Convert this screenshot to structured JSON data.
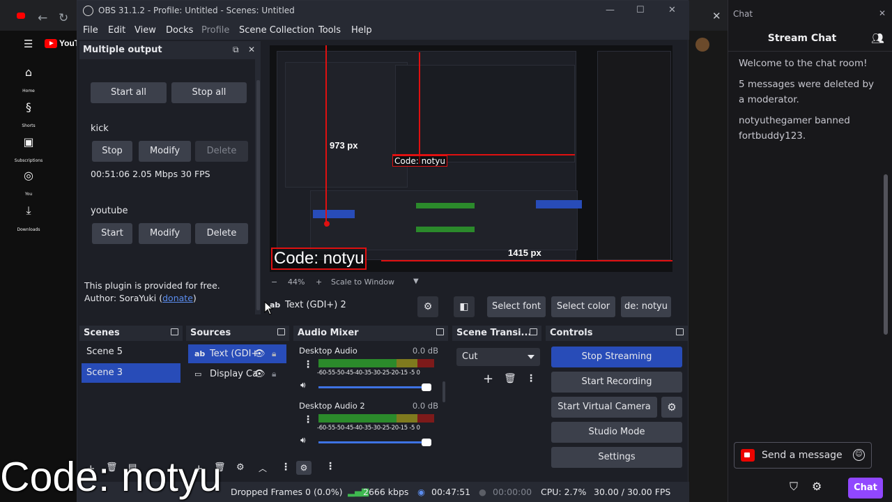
{
  "browser": {
    "youtube_logo": "YouTube",
    "nav": [
      {
        "label": "Home",
        "icon": "home-icon"
      },
      {
        "label": "Shorts",
        "icon": "shorts-icon"
      },
      {
        "label": "Subscriptions",
        "icon": "subscriptions-icon"
      },
      {
        "label": "You",
        "icon": "you-icon"
      },
      {
        "label": "Downloads",
        "icon": "download-icon"
      }
    ]
  },
  "chat": {
    "window_title": "Chat",
    "header": "Stream Chat",
    "messages": [
      "Welcome to the chat room!",
      "5 messages were deleted by a moderator.",
      "notyuthegamer banned fortbuddy123."
    ],
    "input_placeholder": "Send a message",
    "chat_button": "Chat"
  },
  "obs": {
    "title": "OBS 31.1.2 - Profile: Untitled - Scenes: Untitled",
    "menu": [
      "File",
      "Edit",
      "View",
      "Docks",
      "Profile",
      "Scene Collection",
      "Tools",
      "Help"
    ],
    "multiple_output": {
      "title": "Multiple output",
      "start_all": "Start all",
      "stop_all": "Stop all",
      "targets": [
        {
          "name": "kick",
          "buttons": [
            "Stop",
            "Modify",
            "Delete"
          ],
          "stats": "00:51:06  2.05 Mbps  30 FPS"
        },
        {
          "name": "youtube",
          "buttons": [
            "Start",
            "Modify",
            "Delete"
          ]
        }
      ],
      "info_line1": "This plugin is provided for free.",
      "info_line2_prefix": "Author: SoraYuki (",
      "info_link": "donate",
      "info_line2_suffix": ")"
    },
    "preview": {
      "px_label_1": "973 px",
      "px_label_2": "1415 px",
      "code_text": "Code: notyu",
      "zoom": "44%",
      "scale_mode": "Scale to Window"
    },
    "context_bar": {
      "source": "Text (GDI+) 2",
      "select_font": "Select font",
      "select_color": "Select color",
      "text_preview": "de: notyu"
    },
    "scenes": {
      "title": "Scenes",
      "items": [
        "Scene 5",
        "Scene 3"
      ],
      "selected": "Scene 3"
    },
    "sources": {
      "title": "Sources",
      "items": [
        {
          "name": "Text (GDI+",
          "icon": "text-icon"
        },
        {
          "name": "Display Ca",
          "icon": "display-icon"
        }
      ]
    },
    "audio_mixer": {
      "title": "Audio Mixer",
      "ticks": "-60-55-50-45-40-35-30-25-20-15 -5  0",
      "channels": [
        {
          "name": "Desktop Audio",
          "db": "0.0 dB"
        },
        {
          "name": "Desktop Audio 2",
          "db": "0.0 dB"
        }
      ]
    },
    "transitions": {
      "title": "Scene Transi...",
      "selected": "Cut"
    },
    "controls": {
      "title": "Controls",
      "buttons": [
        "Stop Streaming",
        "Start Recording",
        "Start Virtual Camera",
        "Studio Mode",
        "Settings"
      ]
    },
    "status": {
      "dropped": "Dropped Frames 0 (0.0%)",
      "bitrate": "2666 kbps",
      "stream_time": "00:47:51",
      "rec_time": "00:00:00",
      "cpu": "CPU: 2.7%",
      "fps": "30.00 / 30.00 FPS"
    }
  },
  "overlay": {
    "code_text": "Code: notyu"
  },
  "colors": {
    "obs_accent": "#284cb8",
    "twitch_purple": "#9147ff",
    "preview_outline": "#e01010",
    "youtube_red": "#ff0000"
  }
}
